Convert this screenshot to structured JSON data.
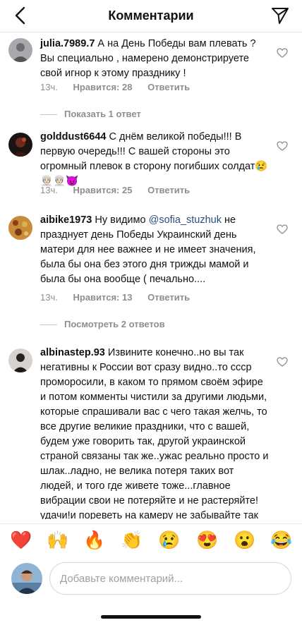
{
  "header": {
    "title": "Комментарии"
  },
  "comments": [
    {
      "username": "julia.7989.7",
      "text": "А на День Победы вам плевать ? Вы специально , намерено  демонстрируете свой игнор к этому празднику !",
      "time": "13ч.",
      "likes": "Нравится: 28",
      "reply": "Ответить",
      "replies": "Показать 1 ответ"
    },
    {
      "username": "golddust6644",
      "text": "С днём великой победы!!! В первую очередь!!! С вашей стороны это огромный плевок в сторону погибших солдат😢👳🏻‍♀️👳🏻‍♀️😈",
      "time": "13ч.",
      "likes": "Нравится: 25",
      "reply": "Ответить"
    },
    {
      "username": "aibike1973",
      "text_before": "Ну видимо ",
      "mention": "@sofia_stuzhuk",
      "text_after": "  не празднует день Победы  Украинский день матери для нее важнее и не имеет значения,  была бы она без этого дня трижды мамой и была бы она вообще ( печально....",
      "time": "13ч.",
      "likes": "Нравится: 13",
      "reply": "Ответить",
      "replies": "Посмотреть 2 ответов"
    },
    {
      "username": "albinastep.93",
      "text": "Извините конечно..но вы так негативны к России вот сразу видно..то ссср проморосили, в каком то прямом своём эфире и потом комменты чистили за другими людьми, которые спрашивали вас с чего такая желчь, то все другие великие праздники, что с вашей, будем уже говорить так, другой украинской страной связаны так же..ужас реально просто и шлак..ладно, не велика потеря таких вот людей, и того где живете тоже...главное вибрации свои не потеряйте и не растеряйте!удачи!и пореветь на камеру не забывайте так же, вес свой помусолить, жопой посверкать и шары поснимать!"
    }
  ],
  "emoji_bar": [
    "❤️",
    "🙌",
    "🔥",
    "👏",
    "😢",
    "😍",
    "😮",
    "😂"
  ],
  "composer": {
    "placeholder": "Добавьте комментарий..."
  },
  "colors": {
    "mention": "#2a4f7f",
    "meta": "#8e8e8e"
  }
}
